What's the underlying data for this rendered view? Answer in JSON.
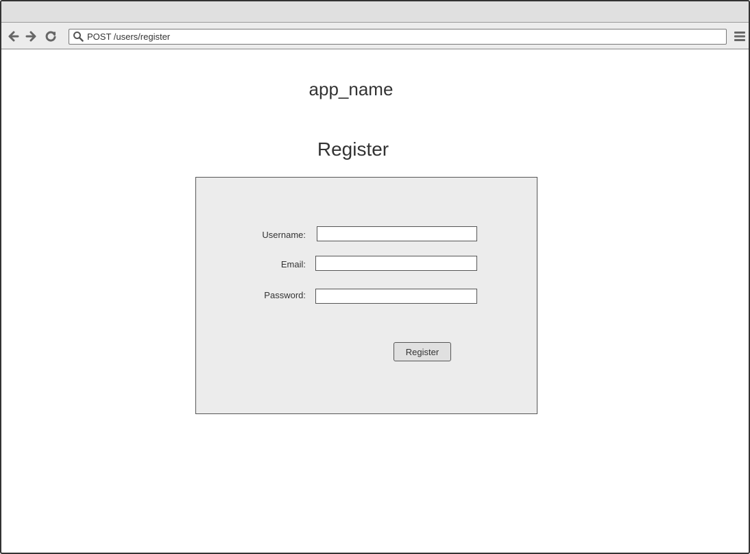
{
  "browser": {
    "address": "POST /users/register",
    "icons": [
      "back-arrow-icon",
      "forward-arrow-icon",
      "reload-icon",
      "search-icon",
      "menu-icon"
    ]
  },
  "page": {
    "app_name": "app_name",
    "title": "Register"
  },
  "form": {
    "username_label": "Username:",
    "email_label": "Email:",
    "password_label": "Password:",
    "username_value": "",
    "email_value": "",
    "password_value": "",
    "submit_label": "Register"
  },
  "colors": {
    "panel_bg": "#ececec",
    "toolbar_bg": "#ececec",
    "border": "#555555",
    "text": "#333333"
  }
}
